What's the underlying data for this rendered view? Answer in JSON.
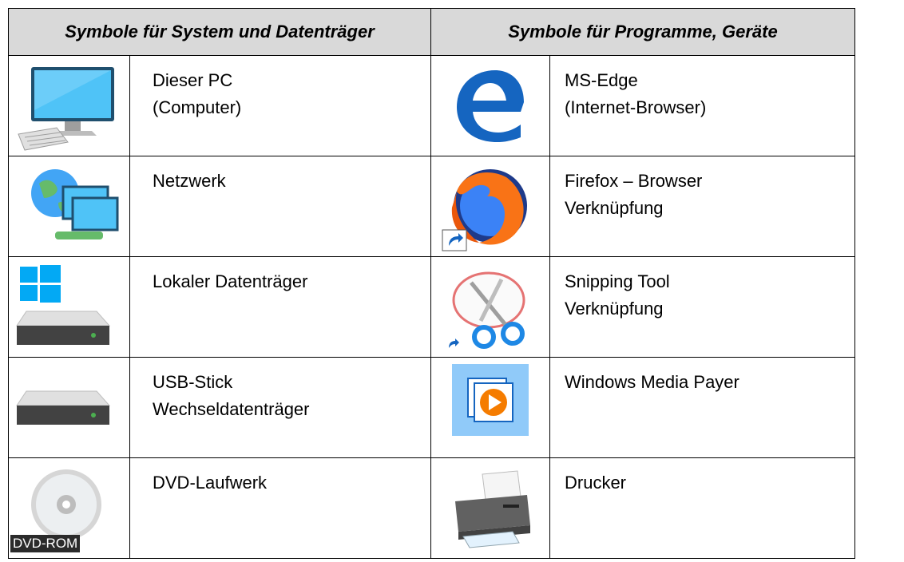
{
  "headers": {
    "left": "Symbole für System und Datenträger",
    "right": "Symbole für Programme, Geräte"
  },
  "left_rows": [
    {
      "icon": "computer-icon",
      "lines": [
        "Dieser PC",
        "(Computer)"
      ]
    },
    {
      "icon": "network-icon",
      "lines": [
        "Netzwerk",
        ""
      ]
    },
    {
      "icon": "local-drive-icon",
      "lines": [
        "Lokaler Datenträger",
        ""
      ]
    },
    {
      "icon": "usb-drive-icon",
      "lines": [
        "USB-Stick",
        "Wechseldatenträger"
      ]
    },
    {
      "icon": "dvd-drive-icon",
      "lines": [
        "DVD-Laufwerk",
        ""
      ],
      "icon_label": "DVD-ROM"
    }
  ],
  "right_rows": [
    {
      "icon": "edge-icon",
      "lines": [
        "MS-Edge",
        "(Internet-Browser)"
      ]
    },
    {
      "icon": "firefox-shortcut-icon",
      "lines": [
        "Firefox – Browser",
        "Verknüpfung"
      ]
    },
    {
      "icon": "snipping-tool-shortcut-icon",
      "lines": [
        "Snipping Tool",
        "Verknüpfung"
      ]
    },
    {
      "icon": "media-player-icon",
      "lines": [
        "Windows Media Payer",
        ""
      ]
    },
    {
      "icon": "printer-icon",
      "lines": [
        "Drucker",
        ""
      ]
    }
  ]
}
